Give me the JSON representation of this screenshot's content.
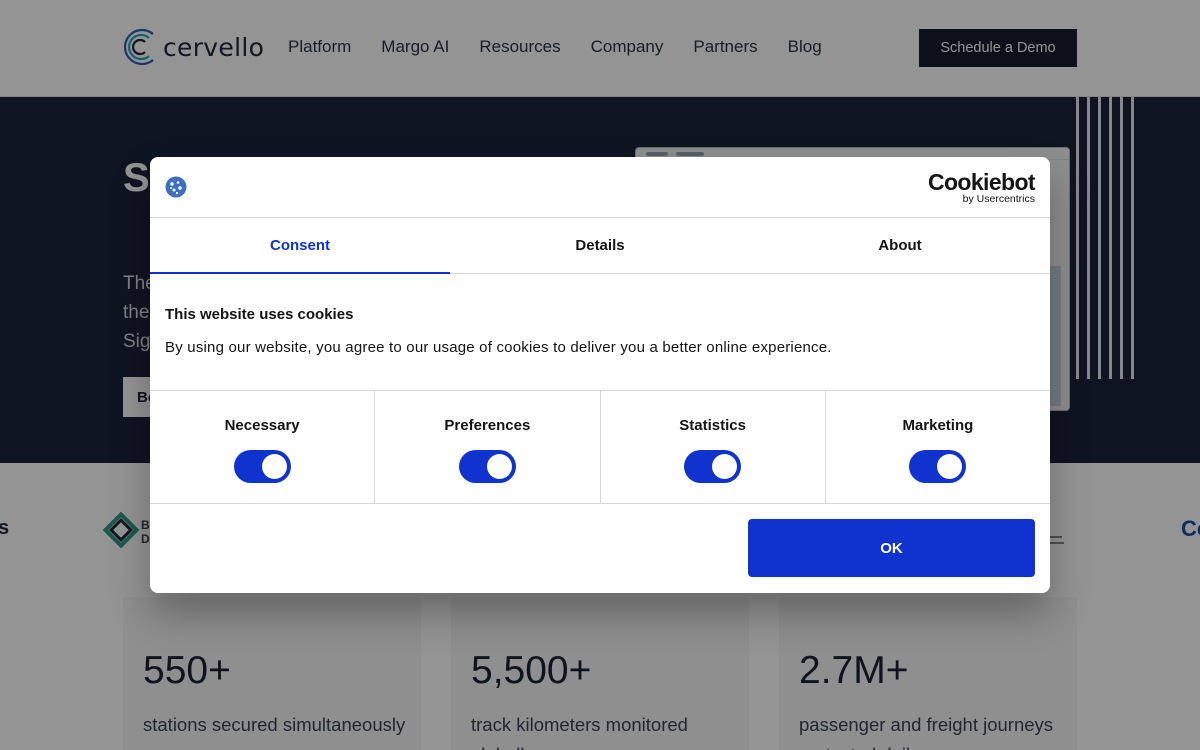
{
  "header": {
    "logo_text": "cervello",
    "nav": [
      "Platform",
      "Margo AI",
      "Resources",
      "Company",
      "Partners",
      "Blog"
    ],
    "cta_label": "Schedule a Demo"
  },
  "hero": {
    "title": "S        R",
    "desc": "The\nthe\nSig",
    "button_label": "Bo"
  },
  "logos_row": {
    "left_partial": "s",
    "bd_text": "B\nD",
    "right_partial": "Co"
  },
  "stats": [
    {
      "value": "550+",
      "label": "stations secured simultaneously"
    },
    {
      "value": "5,500+",
      "label": "track kilometers monitored globally"
    },
    {
      "value": "2.7M+",
      "label": "passenger and freight journeys protected daily"
    }
  ],
  "cookie_dialog": {
    "brand": "Cookiebot",
    "brand_sub": "by Usercentrics",
    "tabs": [
      "Consent",
      "Details",
      "About"
    ],
    "active_tab": "Consent",
    "title": "This website uses cookies",
    "text": "By using our website, you agree to our usage of cookies to deliver you a better online experience.",
    "categories": [
      {
        "label": "Necessary",
        "enabled": true
      },
      {
        "label": "Preferences",
        "enabled": true
      },
      {
        "label": "Statistics",
        "enabled": true
      },
      {
        "label": "Marketing",
        "enabled": true
      }
    ],
    "ok_label": "OK"
  },
  "colors": {
    "accent": "#1032cf",
    "hero_bg": "#1a2339",
    "dark_button": "#151c2f",
    "overlay": "rgba(0,0,0,0.42)"
  }
}
